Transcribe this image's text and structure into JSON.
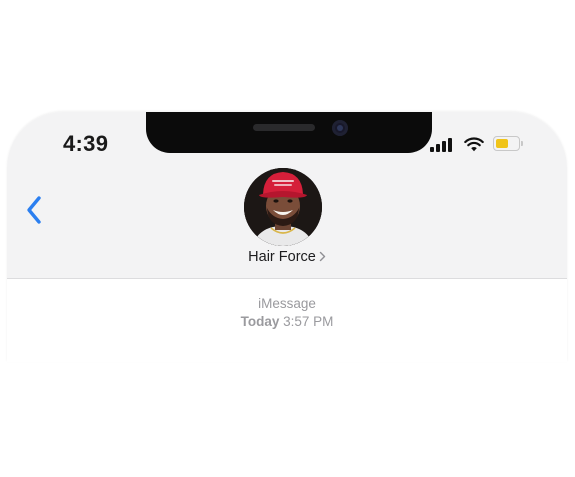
{
  "status_bar": {
    "time": "4:39",
    "signal_bars": 4,
    "battery_level": 0.55,
    "battery_color": "#f0c419"
  },
  "nav": {
    "back_icon": "chevron-left-icon",
    "accent_color": "#2b7ff0"
  },
  "contact": {
    "name": "Hair Force",
    "chevron_icon": "chevron-right-icon",
    "avatar_icon": "contact-photo"
  },
  "thread": {
    "service": "iMessage",
    "day": "Today",
    "time": "3:57 PM"
  }
}
